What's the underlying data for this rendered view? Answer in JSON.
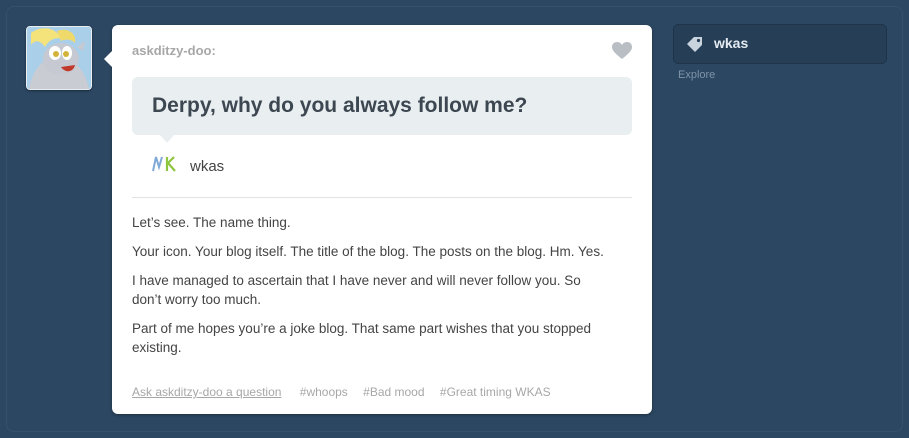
{
  "post": {
    "author": "askditzy-doo:",
    "question": "Derpy, why do you always follow me?",
    "asker": "wkas",
    "answer": [
      "Let’s see. The name thing.",
      "Your icon. Your blog itself. The title of the blog. The posts on the blog. Hm. Yes.",
      "I have managed to ascertain that I have never and will never follow you. So don’t worry too much.",
      "Part of me hopes you’re a joke blog. That same part wishes that you stopped existing."
    ],
    "ask_link": "Ask askditzy-doo a question",
    "tags": [
      "#whoops",
      "#Bad mood",
      "#Great timing WKAS"
    ]
  },
  "sidebar": {
    "tag_label": "wkas",
    "explore": "Explore"
  },
  "icons": {
    "avatar": "pony-avatar",
    "heart": "heart-icon",
    "asker": "wkas-logo-icon",
    "tag": "tag-icon"
  },
  "colors": {
    "background": "#2c4762",
    "card": "#ffffff",
    "question_bubble": "#e9eef0",
    "muted_text": "#a7a7a7"
  }
}
